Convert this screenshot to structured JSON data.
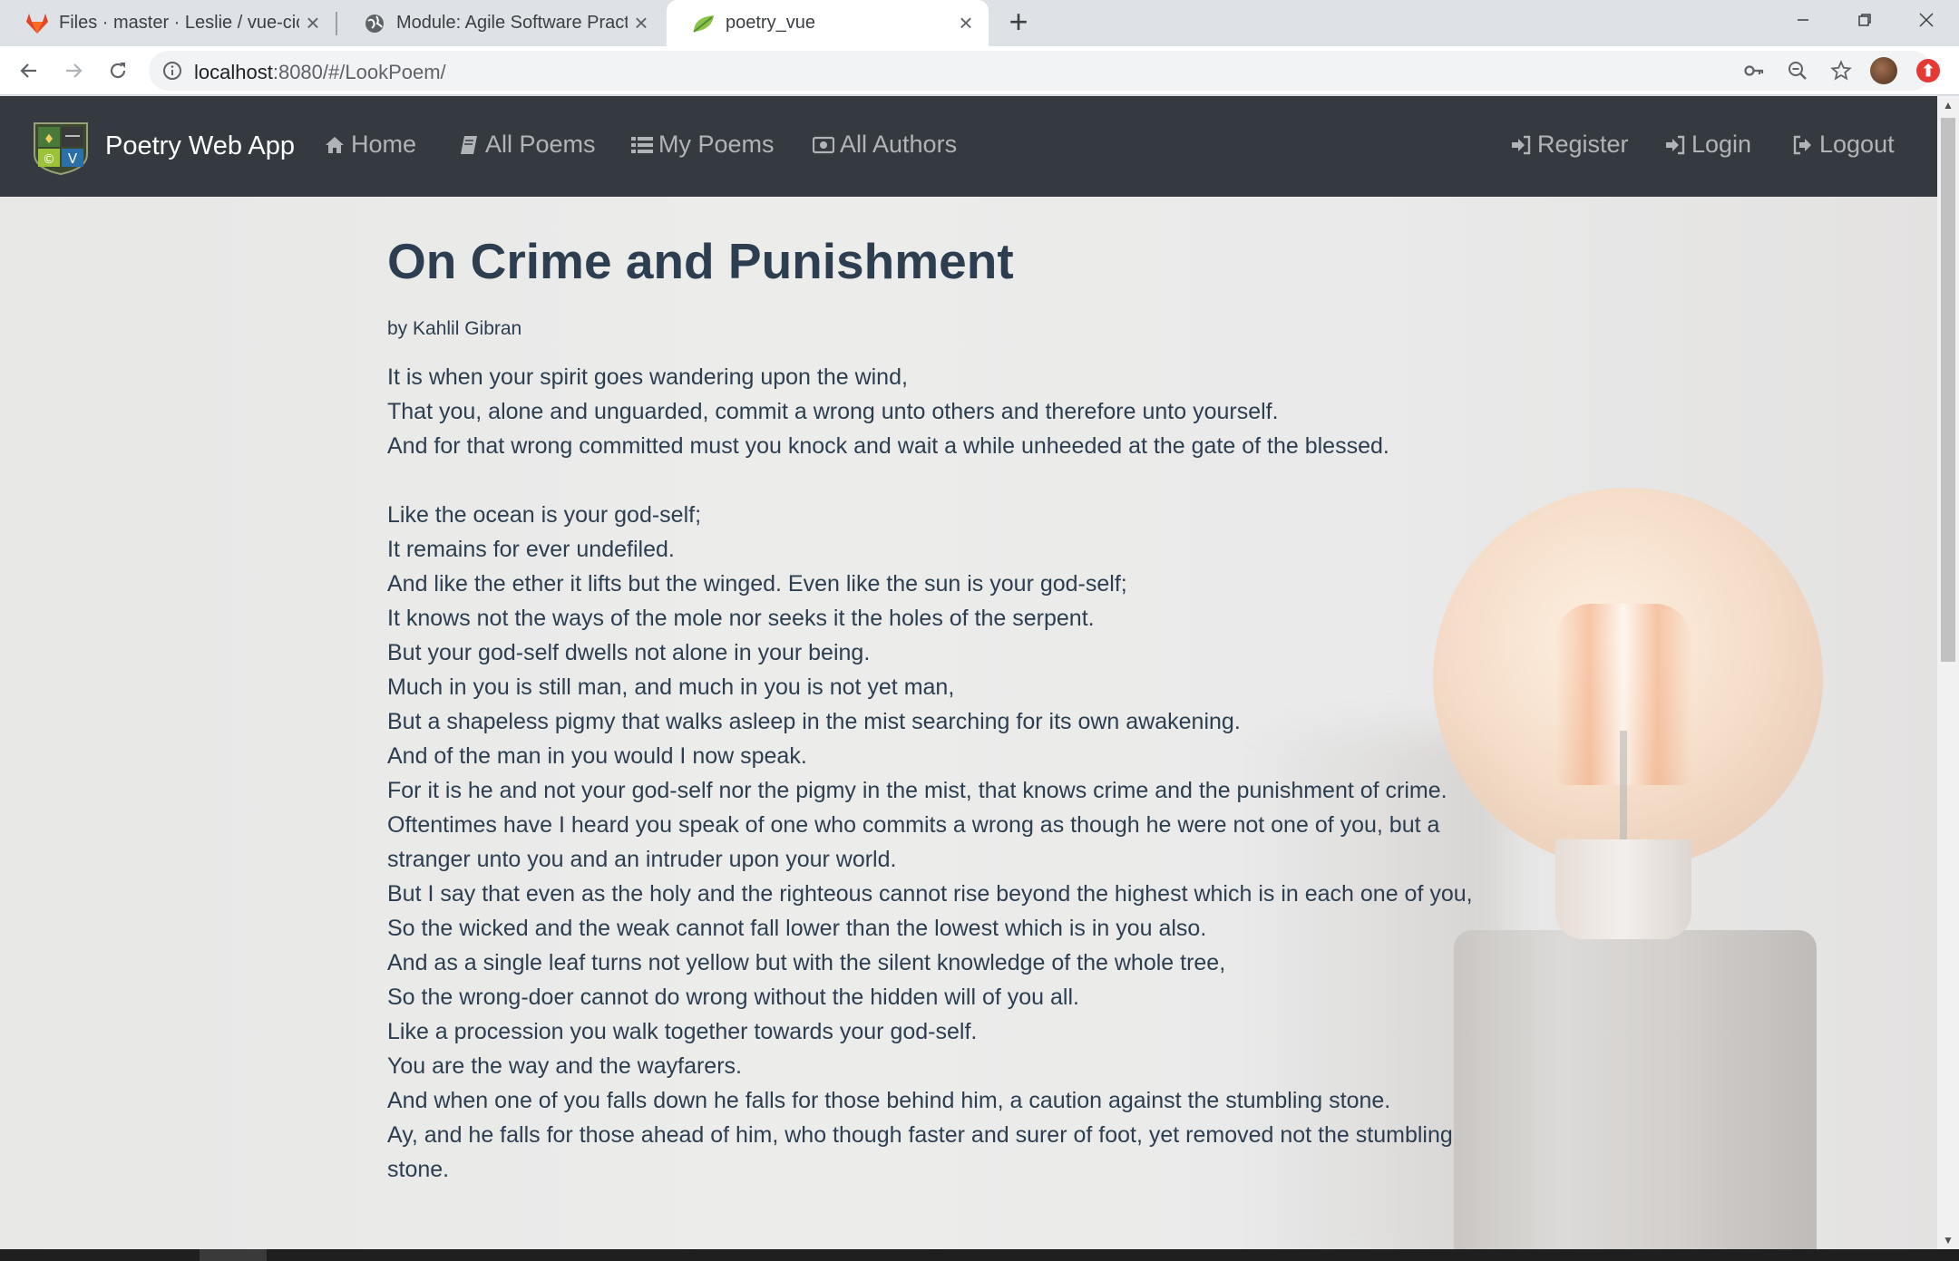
{
  "browser": {
    "tabs": [
      {
        "title": "Files · master · Leslie / vue-cicd",
        "icon": "gitlab-icon",
        "active": false
      },
      {
        "title": "Module: Agile Software Practice",
        "icon": "globe-icon",
        "active": false
      },
      {
        "title": "poetry_vue",
        "icon": "leaf-icon",
        "active": true
      }
    ],
    "new_tab_label": "+",
    "url_host": "localhost",
    "url_rest": ":8080/#/LookPoem/"
  },
  "navbar": {
    "brand": "Poetry Web App",
    "left_links": [
      {
        "label": "Home",
        "icon": "home-icon"
      },
      {
        "label": "All Poems",
        "icon": "book-icon"
      },
      {
        "label": "My Poems",
        "icon": "list-icon"
      },
      {
        "label": "All Authors",
        "icon": "id-card-icon"
      }
    ],
    "right_links": [
      {
        "label": "Register",
        "icon": "sign-in-icon"
      },
      {
        "label": "Login",
        "icon": "sign-in-icon"
      },
      {
        "label": "Logout",
        "icon": "sign-out-icon"
      }
    ]
  },
  "poem": {
    "title": "On Crime and Punishment",
    "author": "by Kahlil Gibran",
    "lines": [
      "It is when your spirit goes wandering upon the wind,",
      "That you, alone and unguarded, commit a wrong unto others and therefore unto yourself.",
      "And for that wrong committed must you knock and wait a while unheeded at the gate of the blessed.",
      "",
      "Like the ocean is your god-self;",
      "It remains for ever undefiled.",
      "And like the ether it lifts but the winged. Even like the sun is your god-self;",
      "It knows not the ways of the mole nor seeks it the holes of the serpent.",
      "But your god-self dwells not alone in your being.",
      "Much in you is still man, and much in you is not yet man,",
      "But a shapeless pigmy that walks asleep in the mist searching for its own awakening.",
      "And of the man in you would I now speak.",
      "For it is he and not your god-self nor the pigmy in the mist, that knows crime and the punishment of crime.",
      "Oftentimes have I heard you speak of one who commits a wrong as though he were not one of you, but a",
      "stranger unto you and an intruder upon your world.",
      "But I say that even as the holy and the righteous cannot rise beyond the highest which is in each one of you,",
      "So the wicked and the weak cannot fall lower than the lowest which is in you also.",
      "And as a single leaf turns not yellow but with the silent knowledge of the whole tree,",
      "So the wrong-doer cannot do wrong without the hidden will of you all.",
      "Like a procession you walk together towards your god-self.",
      "You are the way and the wayfarers.",
      "And when one of you falls down he falls for those behind him, a caution against the stumbling stone.",
      "Ay, and he falls for those ahead of him, who though faster and surer of foot, yet removed not the stumbling",
      "stone."
    ]
  },
  "colors": {
    "navbar_bg": "#343a40",
    "text": "#2c3e50",
    "nav_link": "rgba(255,255,255,0.62)"
  }
}
